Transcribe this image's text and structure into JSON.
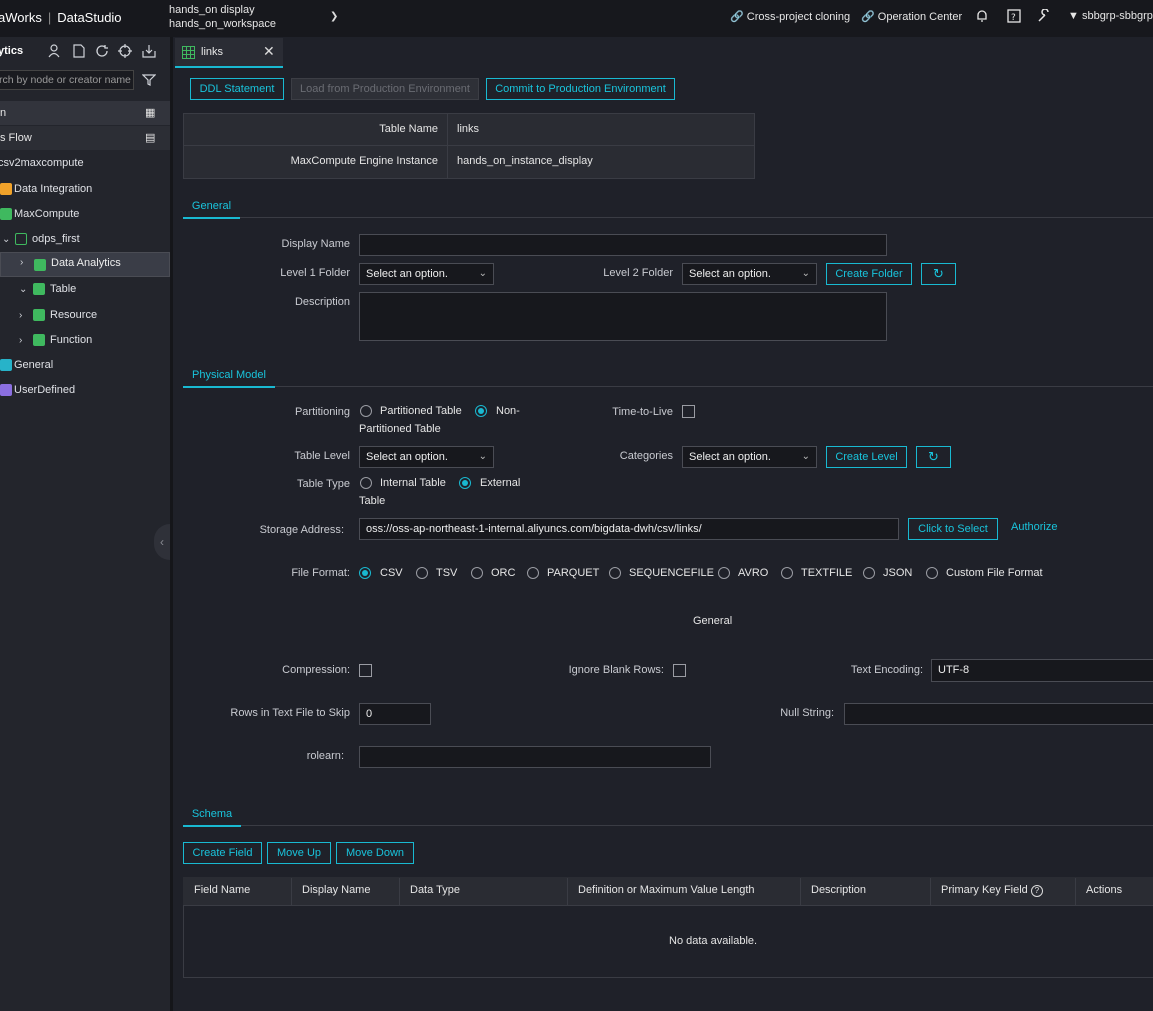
{
  "topbar": {
    "brand": "aWorks",
    "product": "DataStudio",
    "workspace_display": "hands_on display",
    "workspace_name": "hands_on_workspace",
    "links": [
      "Cross-project cloning",
      "Operation Center"
    ],
    "user": "sbbgrp-sbbgrp"
  },
  "sidebar": {
    "title": "ytics",
    "search_placeholder": "rch by node or creator name",
    "section1": "n",
    "section2": "s Flow",
    "items": [
      {
        "label": "csv2maxcompute"
      },
      {
        "label": "Data Integration",
        "color": "#f0a22a"
      },
      {
        "label": "MaxCompute",
        "color": "#3fb95f"
      },
      {
        "label": "odps_first",
        "color": "#3fb95f"
      },
      {
        "label": "Data Analytics",
        "color": "#3fb95f"
      },
      {
        "label": "Table",
        "color": "#3fb95f"
      },
      {
        "label": "Resource",
        "color": "#3fb95f"
      },
      {
        "label": "Function",
        "color": "#3fb95f"
      },
      {
        "label": "General",
        "color": "#27b3c9"
      },
      {
        "label": "UserDefined",
        "color": "#8b6fe0"
      }
    ]
  },
  "tab": {
    "label": "links"
  },
  "toolbar": {
    "ddl": "DDL Statement",
    "load": "Load from Production Environment",
    "commit": "Commit to Production Environment"
  },
  "info": {
    "table_name_label": "Table Name",
    "table_name": "links",
    "engine_label": "MaxCompute Engine Instance",
    "engine": "hands_on_instance_display"
  },
  "general": {
    "tab": "General",
    "display_name_label": "Display Name",
    "display_name": "",
    "level1_label": "Level 1 Folder",
    "level1_value": "Select an option.",
    "level2_label": "Level 2 Folder",
    "level2_value": "Select an option.",
    "create_folder": "Create Folder",
    "description_label": "Description",
    "description": ""
  },
  "physical": {
    "tab": "Physical Model",
    "partitioning_label": "Partitioning",
    "partitioned": "Partitioned Table",
    "non_partitioned_1": "Non-",
    "non_partitioned_2": "Partitioned Table",
    "ttl_label": "Time-to-Live",
    "table_level_label": "Table Level",
    "table_level_value": "Select an option.",
    "categories_label": "Categories",
    "categories_value": "Select an option.",
    "create_level": "Create Level",
    "table_type_label": "Table Type",
    "internal": "Internal Table",
    "external_1": "External",
    "external_2": "Table",
    "storage_label": "Storage Address",
    "storage_value": "oss://oss-ap-northeast-1-internal.aliyuncs.com/bigdata-dwh/csv/links/",
    "click_select": "Click to Select",
    "authorize": "Authorize",
    "file_format_label": "File Format:",
    "formats": [
      "CSV",
      "TSV",
      "ORC",
      "PARQUET",
      "SEQUENCEFILE",
      "AVRO",
      "TEXTFILE",
      "JSON",
      "Custom File Format"
    ],
    "selected_format": "CSV",
    "general_caption": "General",
    "compression_label": "Compression:",
    "ignore_blank_label": "Ignore Blank Rows:",
    "encoding_label": "Text Encoding:",
    "encoding_value": "UTF-8",
    "skip_label": "Rows in Text File to Skip",
    "skip_value": "0",
    "null_label": "Null String:",
    "null_value": "",
    "rolearn_label": "rolearn",
    "rolearn_value": ""
  },
  "schema": {
    "tab": "Schema",
    "create_field": "Create Field",
    "move_up": "Move Up",
    "move_down": "Move Down",
    "columns": [
      "Field Name",
      "Display Name",
      "Data Type",
      "Definition or Maximum Value Length",
      "Description",
      "Primary Key Field",
      "Actions"
    ],
    "empty": "No data available."
  },
  "colors": {
    "accent": "#19b9d1",
    "background": "#1f2129",
    "topbar": "#17181d"
  }
}
